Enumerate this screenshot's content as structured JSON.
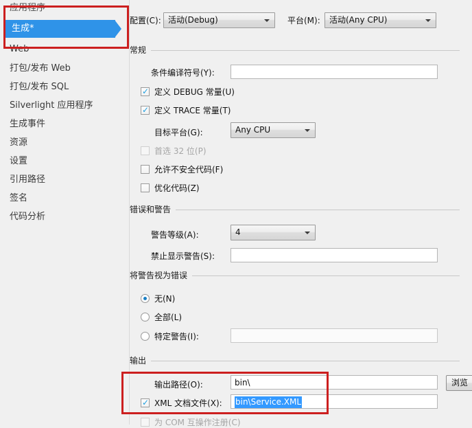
{
  "sidebar": {
    "items": [
      {
        "label": "应用程序",
        "selected": false,
        "cut": true
      },
      {
        "label": "生成*",
        "selected": true,
        "cut": false
      },
      {
        "label": "Web",
        "selected": false,
        "cut": false
      },
      {
        "label": "打包/发布 Web",
        "selected": false,
        "cut": false
      },
      {
        "label": "打包/发布 SQL",
        "selected": false,
        "cut": false
      },
      {
        "label": "Silverlight 应用程序",
        "selected": false,
        "cut": false
      },
      {
        "label": "生成事件",
        "selected": false,
        "cut": false
      },
      {
        "label": "资源",
        "selected": false,
        "cut": false
      },
      {
        "label": "设置",
        "selected": false,
        "cut": false
      },
      {
        "label": "引用路径",
        "selected": false,
        "cut": false
      },
      {
        "label": "签名",
        "selected": false,
        "cut": false
      },
      {
        "label": "代码分析",
        "selected": false,
        "cut": false
      }
    ]
  },
  "topbar": {
    "configuration_label": "配置(C):",
    "configuration_value": "活动(Debug)",
    "platform_label": "平台(M):",
    "platform_value": "活动(Any CPU)"
  },
  "general": {
    "title": "常规",
    "cond_symbols_label": "条件编译符号(Y):",
    "cond_symbols_value": "",
    "define_debug_label": "定义 DEBUG 常量(U)",
    "define_debug_checked": true,
    "define_trace_label": "定义 TRACE 常量(T)",
    "define_trace_checked": true,
    "target_platform_label": "目标平台(G):",
    "target_platform_value": "Any CPU",
    "prefer32_label": "首选 32 位(P)",
    "prefer32_checked": false,
    "unsafe_label": "允许不安全代码(F)",
    "unsafe_checked": false,
    "optimize_label": "优化代码(Z)",
    "optimize_checked": false
  },
  "errors": {
    "title": "错误和警告",
    "warn_level_label": "警告等级(A):",
    "warn_level_value": "4",
    "suppress_label": "禁止显示警告(S):",
    "suppress_value": ""
  },
  "warn_as_error": {
    "title": "将警告视为错误",
    "none_label": "无(N)",
    "all_label": "全部(L)",
    "specific_label": "特定警告(I):",
    "specific_value": "",
    "selected": "none"
  },
  "output": {
    "title": "输出",
    "output_path_label": "输出路径(O):",
    "output_path_value": "bin\\",
    "browse_label": "浏览",
    "xml_doc_label": "XML 文档文件(X):",
    "xml_doc_checked": true,
    "xml_doc_value": "bin\\Service.XML",
    "com_register_label": "为 COM 互操作注册(C)",
    "com_register_checked": false
  },
  "colors": {
    "accent_blue": "#2f93e8",
    "selection_blue": "#3399ff",
    "annotation_red": "#cc1f1f",
    "background": "#f0f0f0"
  }
}
